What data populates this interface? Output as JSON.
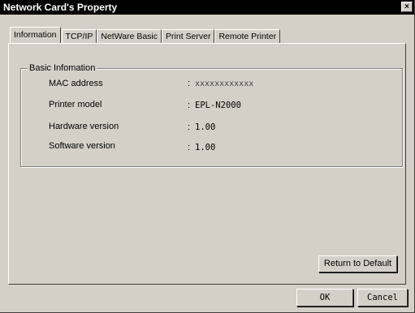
{
  "window": {
    "title": "Network Card's Property",
    "close_glyph": "×"
  },
  "tabs": [
    {
      "label": "Information",
      "active": true
    },
    {
      "label": "TCP/IP",
      "active": false
    },
    {
      "label": "NetWare Basic",
      "active": false
    },
    {
      "label": "Print Server",
      "active": false
    },
    {
      "label": "Remote Printer",
      "active": false
    }
  ],
  "basic_info": {
    "legend": "Basic Infomation",
    "rows": [
      {
        "label": "MAC address",
        "colon": ":",
        "value": "xxxxxxxxxxxx"
      },
      {
        "label": "Printer model",
        "colon": ":",
        "value": "EPL-N2000"
      },
      {
        "label": "Hardware version",
        "colon": ":",
        "value": "1.00"
      },
      {
        "label": "Software version",
        "colon": ":",
        "value": "1.00"
      }
    ]
  },
  "buttons": {
    "return_default": "Return to Default",
    "ok": "OK",
    "cancel": "Cancel"
  },
  "colors": {
    "face": "#d4d0c8",
    "titlebar": "#000000",
    "titlebar_text": "#ffffff"
  }
}
